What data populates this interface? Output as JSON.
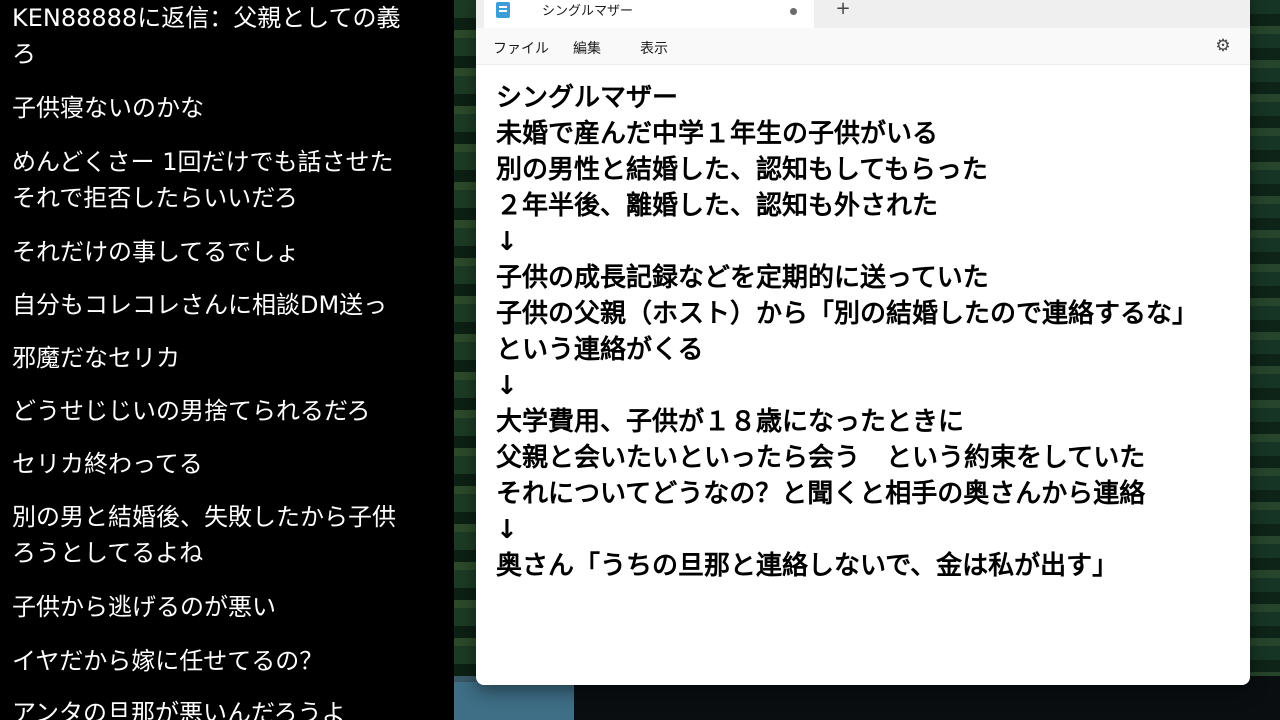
{
  "chat": {
    "messages": [
      {
        "lines": [
          "KEN88888に返信：父親としての義",
          "ろ"
        ]
      },
      {
        "lines": [
          "子供寝ないのかな"
        ]
      },
      {
        "lines": [
          "めんどくさー 1回だけでも話させた",
          "それで拒否したらいいだろ"
        ]
      },
      {
        "lines": [
          "それだけの事してるでしょ"
        ]
      },
      {
        "lines": [
          "自分もコレコレさんに相談DM送っ"
        ]
      },
      {
        "lines": [
          "邪魔だなセリカ"
        ]
      },
      {
        "lines": [
          "どうせじじいの男捨てられるだろ"
        ]
      },
      {
        "lines": [
          "セリカ終わってる"
        ]
      },
      {
        "lines": [
          "別の男と結婚後、失敗したから子供",
          "ろうとしてるよね"
        ]
      },
      {
        "lines": [
          "子供から逃げるのが悪い"
        ]
      },
      {
        "lines": [
          "イヤだから嫁に任せてるの？"
        ]
      },
      {
        "lines": [
          "アンタの旦那が悪いんだろうよ"
        ]
      }
    ]
  },
  "notepad": {
    "tab_title": "シングルマザー",
    "new_tab_label": "+",
    "menu": {
      "file": "ファイル",
      "edit": "編集",
      "view": "表示"
    },
    "lines": [
      "シングルマザー",
      "未婚で産んだ中学１年生の子供がいる",
      "別の男性と結婚した、認知もしてもらった",
      "２年半後、離婚した、認知も外された",
      "↓",
      "子供の成長記録などを定期的に送っていた",
      "子供の父親（ホスト）から「別の結婚したので連絡するな」",
      "という連絡がくる",
      "↓",
      "大学費用、子供が１８歳になったときに",
      "父親と会いたいといったら会う　という約束をしていた",
      "それについてどうなの？と聞くと相手の奥さんから連絡",
      "↓",
      "奥さん「うちの旦那と連絡しないで、金は私が出す」"
    ]
  }
}
